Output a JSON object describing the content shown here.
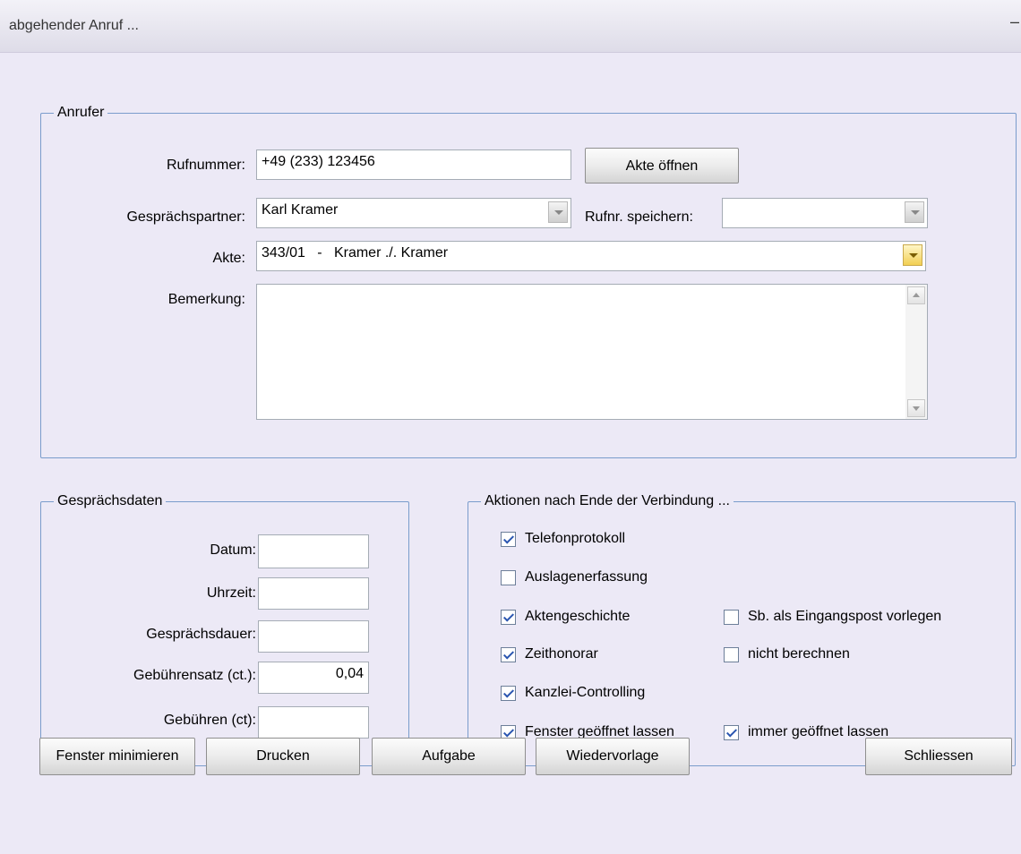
{
  "window": {
    "title": "abgehender Anruf ...",
    "minimize_symbol": "–"
  },
  "caller": {
    "legend": "Anrufer",
    "phone_label": "Rufnummer:",
    "phone_value": "+49 (233) 123456",
    "open_file_button": "Akte öffnen",
    "partner_label": "Gesprächspartner:",
    "partner_value": "Karl Kramer",
    "save_number_label": "Rufnr. speichern:",
    "save_number_value": "",
    "file_label": "Akte:",
    "file_value": "343/01   -   Kramer ./. Kramer",
    "remark_label": "Bemerkung:",
    "remark_value": ""
  },
  "call_data": {
    "legend": "Gesprächsdaten",
    "date_label": "Datum:",
    "date_value": "",
    "time_label": "Uhrzeit:",
    "time_value": "",
    "duration_label": "Gesprächsdauer:",
    "duration_value": "",
    "rate_label": "Gebührensatz (ct.):",
    "rate_value": "0,04",
    "fees_label": "Gebühren (ct):",
    "fees_value": ""
  },
  "actions": {
    "legend": "Aktionen nach Ende der Verbindung ...",
    "items": [
      {
        "label": "Telefonprotokoll",
        "checked": true
      },
      {
        "label": "Auslagenerfassung",
        "checked": false
      },
      {
        "label": "Aktengeschichte",
        "checked": true
      },
      {
        "label": "Sb. als Eingangspost vorlegen",
        "checked": false
      },
      {
        "label": "Zeithonorar",
        "checked": true
      },
      {
        "label": "nicht berechnen",
        "checked": false
      },
      {
        "label": "Kanzlei-Controlling",
        "checked": true
      },
      {
        "label": "Fenster geöffnet lassen",
        "checked": true
      },
      {
        "label": "immer geöffnet lassen",
        "checked": true
      }
    ]
  },
  "buttons": {
    "minimize_window": "Fenster minimieren",
    "print": "Drucken",
    "task": "Aufgabe",
    "resubmission": "Wiedervorlage",
    "close": "Schliessen"
  },
  "colors": {
    "background": "#ece9f6",
    "group_border": "#7a9ccc",
    "checkmark": "#2a55b0"
  }
}
